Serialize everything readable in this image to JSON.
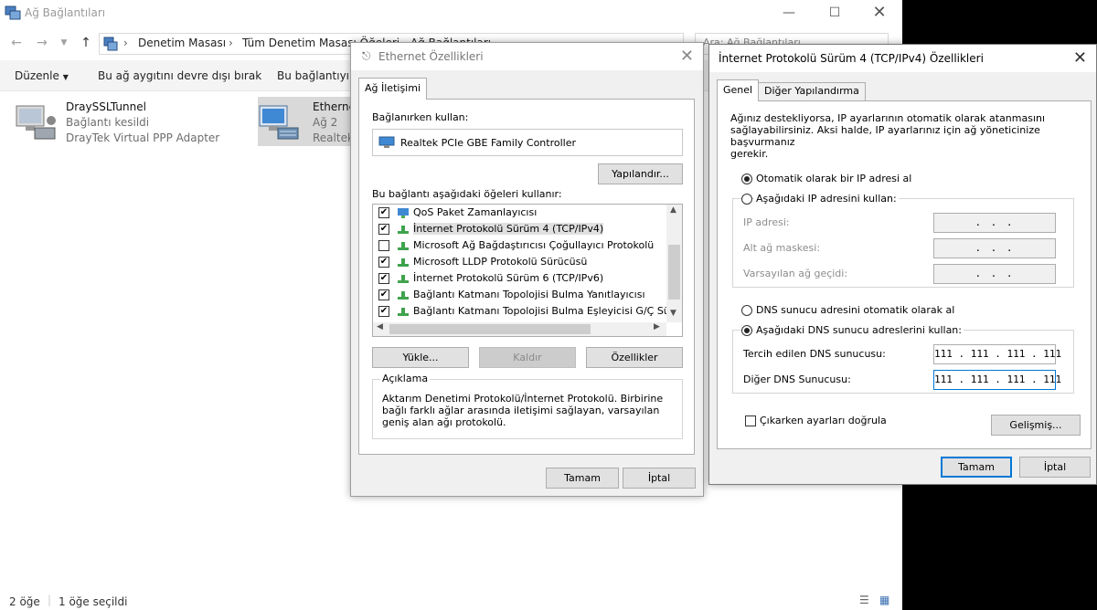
{
  "explorer": {
    "title": "Ağ Bağlantıları",
    "breadcrumb": [
      "Denetim Masası",
      "Tüm Denetim Masası Öğeleri",
      "Ağ Bağlantıları"
    ],
    "search_placeholder": "Ara: Ağ Bağlantıları",
    "commands": {
      "organize": "Düzenle",
      "disable": "Bu ağ aygıtını devre dışı bırak",
      "diagnose": "Bu bağlantıyı tanıla"
    },
    "connections": [
      {
        "name": "DraySSLTunnel",
        "status": "Bağlantı kesildi",
        "adapter": "DrayTek Virtual PPP Adapter"
      },
      {
        "name": "Ethernet",
        "status": "Ağ 2",
        "adapter": "Realtek PCIe GBE Family Controller"
      }
    ],
    "status": {
      "count": "2 öğe",
      "selected": "1 öğe seçildi"
    }
  },
  "ethernet_dialog": {
    "title": "Ethernet Özellikleri",
    "tab": "Ağ İletişimi",
    "connect_using_label": "Bağlanırken kullan:",
    "adapter": "Realtek PCIe GBE Family Controller",
    "configure_btn": "Yapılandır...",
    "items_label": "Bu bağlantı aşağıdaki öğeleri kullanır:",
    "items": [
      {
        "label": "QoS Paket Zamanlayıcısı",
        "checked": "✔"
      },
      {
        "label": "İnternet Protokolü Sürüm 4 (TCP/IPv4)",
        "checked": "✔"
      },
      {
        "label": "Microsoft Ağ Bağdaştırıcısı Çoğullayıcı Protokolü",
        "checked": ""
      },
      {
        "label": "Microsoft LLDP Protokolü Sürücüsü",
        "checked": "✔"
      },
      {
        "label": "İnternet Protokolü Sürüm 6 (TCP/IPv6)",
        "checked": "✔"
      },
      {
        "label": "Bağlantı Katmanı Topolojisi Bulma Yanıtlayıcısı",
        "checked": "✔"
      },
      {
        "label": "Bağlantı Katmanı Topolojisi Bulma Eşleyicisi G/Ç Sürücü",
        "checked": "✔"
      }
    ],
    "install_btn": "Yükle...",
    "uninstall_btn": "Kaldır",
    "properties_btn": "Özellikler",
    "description_title": "Açıklama",
    "description": "Aktarım Denetimi Protokolü/İnternet Protokolü. Birbirine bağlı farklı ağlar arasında iletişimi sağlayan, varsayılan geniş alan ağı protokolü.",
    "ok_btn": "Tamam",
    "cancel_btn": "İptal"
  },
  "ipv4_dialog": {
    "title": "İnternet Protokolü Sürüm 4 (TCP/IPv4) Özellikleri",
    "tabs": [
      "Genel",
      "Diğer Yapılandırma"
    ],
    "intro": [
      "Ağınız destekliyorsa, IP ayarlarının otomatik olarak atanmasını",
      "sağlayabilirsiniz. Aksi halde, IP ayarlarınız için ağ yöneticinize başvurmanız",
      "gerekir."
    ],
    "auto_ip": "Otomatik olarak bir IP adresi al",
    "manual_ip": "Aşağıdaki IP adresini kullan:",
    "ip_address_label": "IP adresi:",
    "subnet_label": "Alt ağ maskesi:",
    "gateway_label": "Varsayılan ağ geçidi:",
    "empty_ip": ". . .",
    "auto_dns": "DNS sunucu adresini otomatik olarak al",
    "manual_dns": "Aşağıdaki DNS sunucu adreslerini kullan:",
    "preferred_dns_label": "Tercih edilen DNS sunucusu:",
    "preferred_dns": "111 . 111 . 111 . 111",
    "alternate_dns_label": "Diğer DNS Sunucusu:",
    "alternate_dns": "111 . 111 . 111 . 111",
    "validate_label": "Çıkarken ayarları doğrula",
    "advanced_btn": "Gelişmiş...",
    "ok_btn": "Tamam",
    "cancel_btn": "İptal"
  }
}
